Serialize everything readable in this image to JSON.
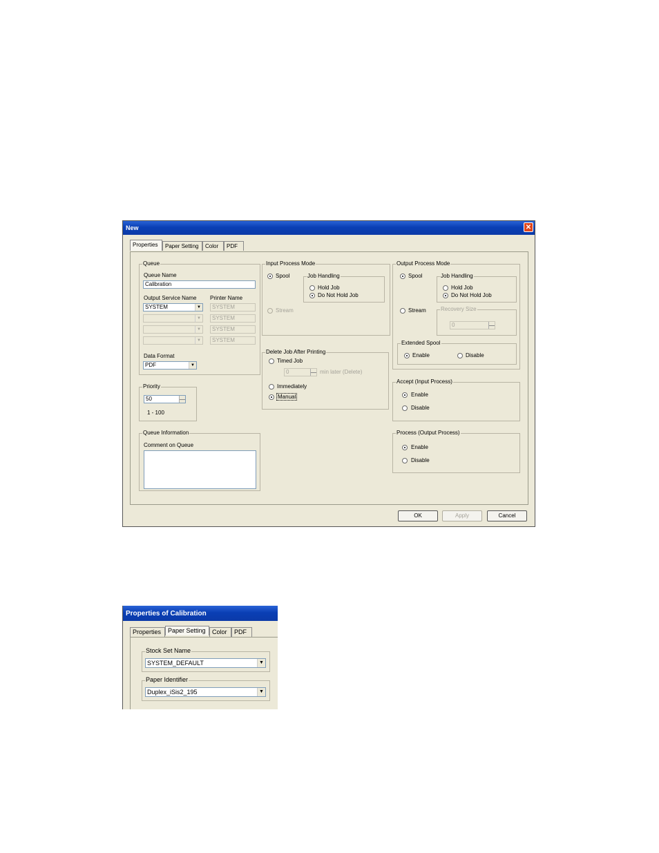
{
  "dialog_new": {
    "title": "New",
    "close": "✕",
    "tabs": [
      "Properties",
      "Paper Setting",
      "Color",
      "PDF"
    ],
    "queue": {
      "legend": "Queue",
      "queue_name_label": "Queue Name",
      "queue_name_value": "Calibration",
      "output_service_label": "Output Service Name",
      "printer_name_label": "Printer Name",
      "output_service_rows": [
        "SYSTEM",
        "",
        "",
        ""
      ],
      "printer_rows": [
        "SYSTEM",
        "SYSTEM",
        "SYSTEM",
        "SYSTEM"
      ],
      "data_format_label": "Data Format",
      "data_format_value": "PDF"
    },
    "priority": {
      "legend": "Priority",
      "value": "50",
      "range": "1 - 100"
    },
    "queue_info": {
      "legend": "Queue Information",
      "comment_label": "Comment on Queue",
      "comment_value": ""
    },
    "input_mode": {
      "legend": "Input Process Mode",
      "spool": "Spool",
      "stream": "Stream",
      "job_handling_legend": "Job Handling",
      "hold_job": "Hold Job",
      "do_not_hold_job": "Do Not Hold Job"
    },
    "delete_job": {
      "legend": "Delete Job After Printing",
      "timed_job": "Timed Job",
      "timed_value": "0",
      "min_later": "min later (Delete)",
      "immediately": "Immediately",
      "manual": "Manual"
    },
    "output_mode": {
      "legend": "Output Process Mode",
      "spool": "Spool",
      "stream": "Stream",
      "job_handling_legend": "Job Handling",
      "hold_job": "Hold Job",
      "do_not_hold_job": "Do Not Hold Job",
      "recovery_size_label": "Recovery Size",
      "recovery_size_value": "0",
      "extended_spool_legend": "Extended Spool",
      "enable": "Enable",
      "disable": "Disable"
    },
    "accept": {
      "legend": "Accept (Input Process)",
      "enable": "Enable",
      "disable": "Disable"
    },
    "process": {
      "legend": "Process (Output Process)",
      "enable": "Enable",
      "disable": "Disable"
    },
    "buttons": {
      "ok": "OK",
      "apply": "Apply",
      "cancel": "Cancel"
    }
  },
  "dialog_props": {
    "title": "Properties of Calibration",
    "tabs": [
      "Properties",
      "Paper Setting",
      "Color",
      "PDF"
    ],
    "stock_set": {
      "legend": "Stock Set Name",
      "value": "SYSTEM_DEFAULT"
    },
    "paper_id": {
      "legend": "Paper Identifier",
      "value": "Duplex_iSis2_195"
    }
  }
}
